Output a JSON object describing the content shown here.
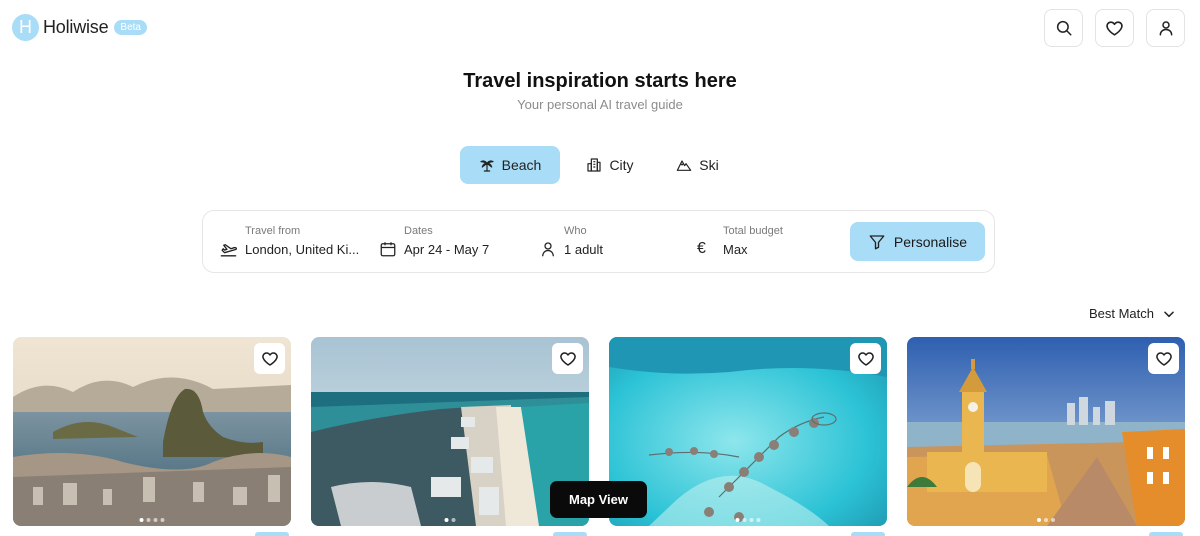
{
  "brand": {
    "logo_letter": "H",
    "name": "Holiwise",
    "badge": "Beta"
  },
  "header": {
    "icons": [
      "search-icon",
      "heart-icon",
      "user-icon"
    ]
  },
  "hero": {
    "title": "Travel inspiration starts here",
    "subtitle": "Your personal AI travel guide"
  },
  "tabs": [
    {
      "label": "Beach",
      "icon": "palm-tree-icon",
      "active": true
    },
    {
      "label": "City",
      "icon": "buildings-icon",
      "active": false
    },
    {
      "label": "Ski",
      "icon": "mountain-icon",
      "active": false
    }
  ],
  "search": {
    "travel_from": {
      "label": "Travel from",
      "value": "London, United Ki..."
    },
    "dates": {
      "label": "Dates",
      "value": "Apr 24 - May 7"
    },
    "who": {
      "label": "Who",
      "value": "1 adult"
    },
    "budget": {
      "label": "Total budget",
      "value": "Max",
      "currency_symbol": "€"
    },
    "personalise_label": "Personalise"
  },
  "sort": {
    "label": "Best Match"
  },
  "cards": [
    {
      "scene": "rio-de-janeiro-bay",
      "dots_total": 4,
      "active_dot": 0
    },
    {
      "scene": "cancun-hotel-strip",
      "dots_total": 2,
      "active_dot": 0
    },
    {
      "scene": "maldives-overwater-villas",
      "dots_total": 4,
      "active_dot": 0
    },
    {
      "scene": "cartagena-clock-tower",
      "dots_total": 3,
      "active_dot": 0
    }
  ],
  "map_view_label": "Map View",
  "colors": {
    "accent": "#a9dcf7",
    "dark": "#0a0a0a",
    "text": "#1a1a1a",
    "muted": "#8c8c8c"
  }
}
